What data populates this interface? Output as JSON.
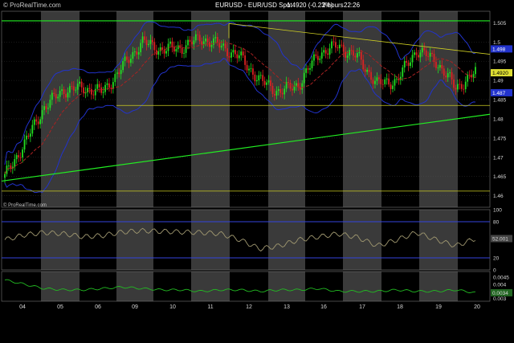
{
  "header": {
    "watermark": "© ProRealTime.com",
    "title": "EURUSD - EUR/USD Spot",
    "price_change": "1.4920 (-0.23%)",
    "timeframe": "2 hours",
    "time": "22:26"
  },
  "price_panel": {
    "watermark": "© ProRealTime.com",
    "y_ticks": [
      "1.505",
      "1.5",
      "1.495",
      "1.49",
      "1.485",
      "1.48",
      "1.475",
      "1.47",
      "1.465",
      "1.46"
    ],
    "y_range": [
      1.457,
      1.508
    ],
    "last_price_label": "1.4920",
    "upper_band_label": "1.498",
    "lower_band_label": "1.487"
  },
  "rsi_panel": {
    "y_ticks": [
      "100",
      "80",
      "50",
      "20",
      "0"
    ],
    "y_range": [
      0,
      100
    ],
    "value_label": "52.001"
  },
  "atr_panel": {
    "y_ticks": [
      "0.0045",
      "0.004",
      "0.0035",
      "0.003"
    ],
    "y_range": [
      0.0028,
      0.0049
    ],
    "value_label": "0.0034"
  },
  "x_axis": {
    "labels": [
      "04",
      "05",
      "06",
      "09",
      "10",
      "11",
      "12",
      "13",
      "16",
      "17",
      "18",
      "19",
      "20"
    ]
  },
  "colors": {
    "background": "#000000",
    "shaded_band": "#3a3a3a",
    "bull_candle": "#22dd22",
    "bear_candle": "#dd2222",
    "bollinger": "#2233cc",
    "moving_average": "#aa2222",
    "trend_green": "#22ee22",
    "trend_yellow": "#cccc22",
    "rsi_line": "#a09870",
    "atr_line": "#22bb22",
    "last_price_box": "#dddd33"
  },
  "chart_data": [
    {
      "type": "candlestick",
      "title": "EURUSD - EUR/USD Spot",
      "series_anchor_closes": [
        {
          "x": "04",
          "y": 1.465
        },
        {
          "x": "04.5",
          "y": 1.4735
        },
        {
          "x": "05",
          "y": 1.483
        },
        {
          "x": "05.5",
          "y": 1.4875
        },
        {
          "x": "06",
          "y": 1.488
        },
        {
          "x": "06.5",
          "y": 1.487
        },
        {
          "x": "09",
          "y": 1.4935
        },
        {
          "x": "09.5",
          "y": 1.5
        },
        {
          "x": "10",
          "y": 1.498
        },
        {
          "x": "10.5",
          "y": 1.4985
        },
        {
          "x": "11",
          "y": 1.501
        },
        {
          "x": "11.5",
          "y": 1.499
        },
        {
          "x": "12",
          "y": 1.496
        },
        {
          "x": "12.5",
          "y": 1.49
        },
        {
          "x": "13",
          "y": 1.487
        },
        {
          "x": "13.5",
          "y": 1.489
        },
        {
          "x": "16",
          "y": 1.497
        },
        {
          "x": "16.5",
          "y": 1.499
        },
        {
          "x": "17",
          "y": 1.496
        },
        {
          "x": "17.5",
          "y": 1.489
        },
        {
          "x": "18",
          "y": 1.49
        },
        {
          "x": "18.5",
          "y": 1.498
        },
        {
          "x": "19",
          "y": 1.495
        },
        {
          "x": "19.5",
          "y": 1.488
        },
        {
          "x": "20",
          "y": 1.492
        }
      ]
    },
    {
      "type": "line",
      "name": "RSI",
      "values_anchor": [
        50,
        58,
        62,
        60,
        55,
        57,
        63,
        65,
        64,
        63,
        62,
        60,
        50,
        35,
        40,
        50,
        55,
        60,
        54,
        40,
        50,
        62,
        50,
        40,
        52
      ]
    },
    {
      "type": "line",
      "name": "ATR",
      "values_anchor": [
        0.0043,
        0.004,
        0.0037,
        0.0036,
        0.0036,
        0.0037,
        0.0038,
        0.0037,
        0.0036,
        0.0036,
        0.0035,
        0.0036,
        0.0036,
        0.0035,
        0.0036,
        0.0036,
        0.0037,
        0.0035,
        0.0035,
        0.0035,
        0.0036,
        0.0035,
        0.0035,
        0.0036,
        0.0034
      ]
    }
  ]
}
